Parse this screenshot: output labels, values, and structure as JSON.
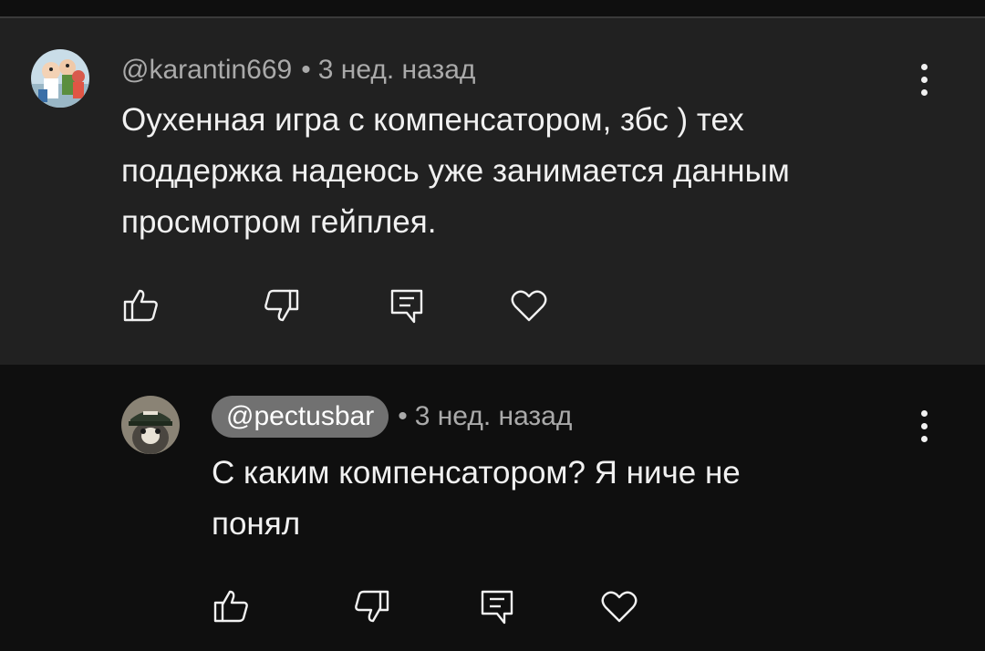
{
  "comments": [
    {
      "author": "@karantin669",
      "time": "3 нед. назад",
      "separator": "•",
      "text_lines": [
        "Оухенная игра с компенсатором,  збс ) тех",
        "поддержка надеюсь уже занимается данным",
        "просмотром гейплея."
      ],
      "avatar_icon": "family-cartoon-avatar"
    },
    {
      "author": "@pectusbar",
      "time": "3 нед. назад",
      "separator": "•",
      "text_lines": [
        "С каким компенсатором? Я ниче не",
        "понял"
      ],
      "avatar_icon": "cat-in-cap-avatar"
    }
  ],
  "actions": {
    "like_icon": "thumb-up-icon",
    "dislike_icon": "thumb-down-icon",
    "reply_icon": "reply-icon",
    "heart_icon": "heart-icon",
    "menu_icon": "more-vert-icon"
  },
  "colors": {
    "highlight_bg": "#212121",
    "page_bg": "#0f0f0f",
    "meta_text": "#aaaaaa",
    "body_text": "#f1f1f1",
    "handle_pill": "#717171"
  }
}
